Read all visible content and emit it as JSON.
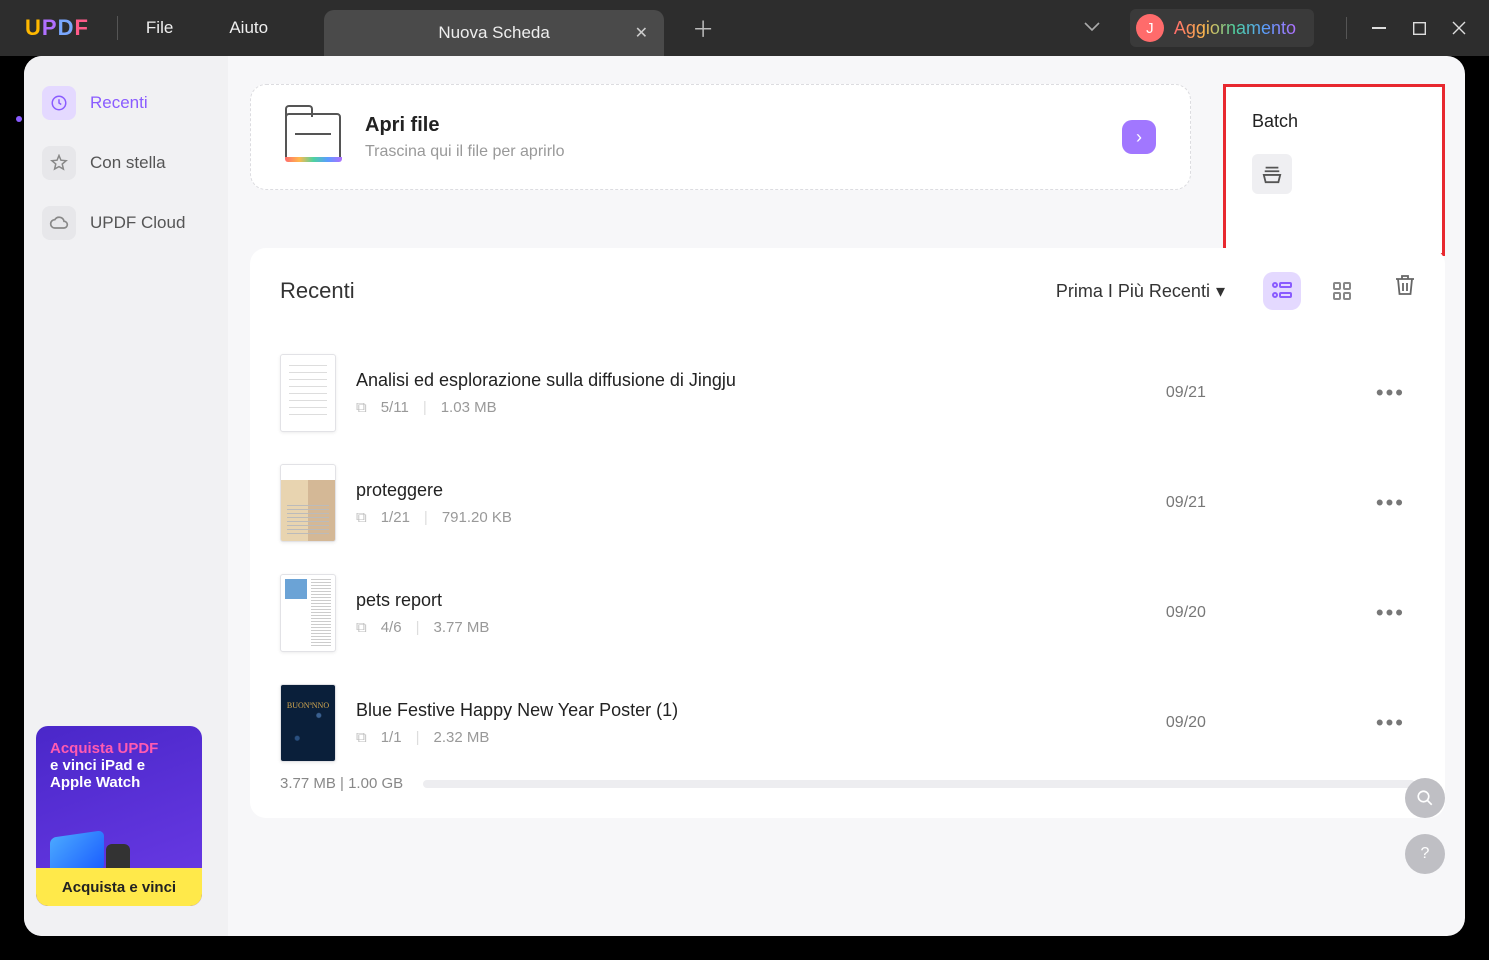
{
  "menu": {
    "file": "File",
    "help": "Aiuto"
  },
  "tab": {
    "title": "Nuova Scheda"
  },
  "update": {
    "avatar": "J",
    "label": "Aggiornamento"
  },
  "sidebar": {
    "recent": "Recenti",
    "starred": "Con stella",
    "cloud": "UPDF Cloud"
  },
  "promo": {
    "line1": "Acquista UPDF",
    "line2": "e vinci iPad e",
    "line3": "Apple Watch",
    "button": "Acquista e vinci"
  },
  "drop": {
    "title": "Apri file",
    "sub": "Trascina qui il file per aprirlo"
  },
  "batch": {
    "title": "Batch"
  },
  "recent": {
    "title": "Recenti",
    "sort": "Prima I Più Recenti"
  },
  "files": [
    {
      "name": "Analisi ed esplorazione sulla diffusione di Jingju",
      "pages": "5/11",
      "size": "1.03 MB",
      "date": "09/21"
    },
    {
      "name": "proteggere",
      "pages": "1/21",
      "size": "791.20 KB",
      "date": "09/21"
    },
    {
      "name": "pets report",
      "pages": "4/6",
      "size": "3.77 MB",
      "date": "09/20"
    },
    {
      "name": "Blue Festive Happy New Year Poster (1)",
      "pages": "1/1",
      "size": "2.32 MB",
      "date": "09/20"
    }
  ],
  "storage": {
    "text": "3.77 MB | 1.00 GB"
  }
}
